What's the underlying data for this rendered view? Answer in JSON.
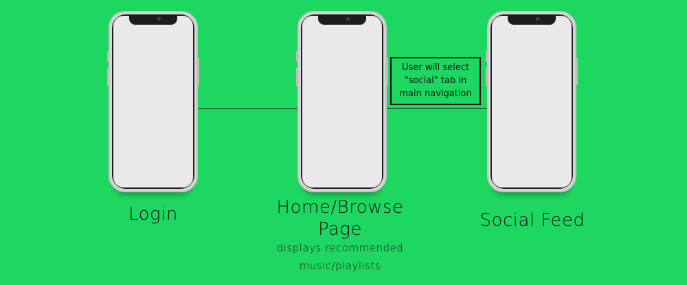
{
  "screens": [
    {
      "title": "Login",
      "subtitle": ""
    },
    {
      "title_lines": [
        "Home/Browse",
        "Page"
      ],
      "subtitle_lines": [
        "displays recommended",
        "music/playlists"
      ]
    },
    {
      "title": "Social Feed",
      "subtitle": ""
    }
  ],
  "annotation": {
    "lines": [
      "User will select",
      "\"social\" tab in",
      "main navigation"
    ]
  },
  "colors": {
    "background": "#1ed760",
    "connector": "#111111"
  },
  "icons": [
    "smartphone-icon"
  ]
}
